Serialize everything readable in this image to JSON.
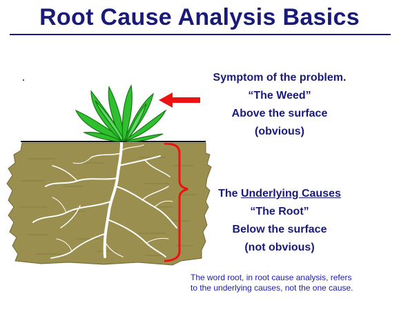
{
  "title": "Root Cause Analysis Basics",
  "symptom": {
    "line1": "Symptom of the problem.",
    "line2": "“The Weed”",
    "line3": "Above the surface",
    "line4": "(obvious)"
  },
  "causes": {
    "line1_prefix": "The ",
    "line1_underlined": "Underlying Causes",
    "line2": "“The Root”",
    "line3": "Below the surface",
    "line4": "(not obvious)"
  },
  "note": {
    "line1": "The word root, in root cause analysis, refers",
    "line2": "to the underlying causes, not the one cause."
  },
  "colors": {
    "title": "#1a1a7a",
    "text": "#1a1a7a",
    "note": "#1a1aaa",
    "soil": "#9a8f4e",
    "soil_dark": "#6f6636",
    "leaves": "#2fbf2f",
    "leaves_dark": "#137a13",
    "roots": "#ffffff",
    "arrow": "#ee1111",
    "bracket": "#ee1111"
  },
  "icons": [
    "weed-plant-icon",
    "soil-with-roots-icon",
    "red-arrow-icon",
    "red-bracket-icon"
  ]
}
